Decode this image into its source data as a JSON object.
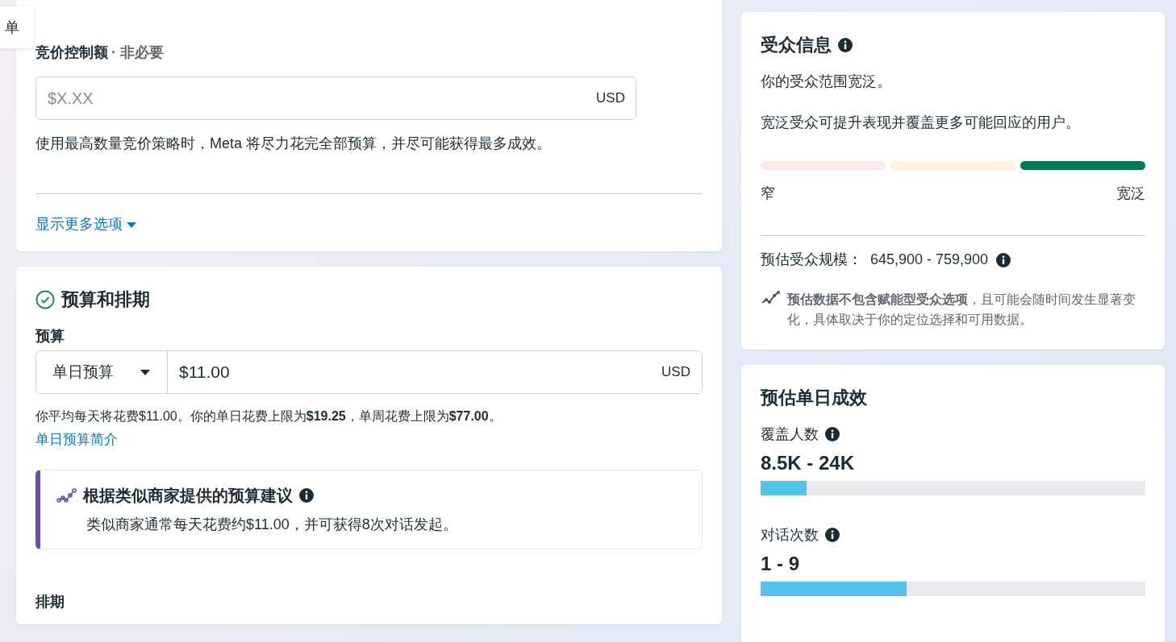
{
  "side_tab": {
    "label": "单"
  },
  "bid_card": {
    "label": "竞价控制额",
    "optional": "· 非必要",
    "field": {
      "placeholder": "$X.XX",
      "suffix": "USD"
    },
    "help": "使用最高数量竞价策略时，Meta 将尽力花完全部预算，并尽可能获得最多成效。",
    "more_link": "显示更多选项"
  },
  "budget_card": {
    "title": "预算和排期",
    "budget_label": "预算",
    "budget_type": "单日预算",
    "amount": "$11.00",
    "currency": "USD",
    "help": "你平均每天将花费$11.00。你的单日花费上限为**$19.25**，单周花费上限为**$77.00**。",
    "link": "单日预算简介",
    "suggestion": {
      "title": "根据类似商家提供的预算建议",
      "text": "类似商家通常每天花费约$11.00，并可获得8次对话发起。"
    },
    "schedule_label": "排期"
  },
  "audience_card": {
    "title": "受众信息",
    "summary": "你的受众范围宽泛。",
    "detail": "宽泛受众可提升表现并覆盖更多可能回应的用户。",
    "meter": [
      {
        "color": "#fde8e9"
      },
      {
        "color": "#fff3da"
      },
      {
        "color": "#007a56"
      }
    ],
    "low_label": "窄",
    "high_label": "宽泛",
    "size_label": "预估受众规模：",
    "size_value": "645,900 - 759,900",
    "note": "**预估数据不包含赋能型受众选项**，且可能会随时间发生显著变化，具体取决于你的定位选择和可用数据。"
  },
  "results_card": {
    "title": "预估单日成效",
    "metrics": [
      {
        "label": "覆盖人数",
        "value": "8.5K - 24K",
        "level": 0.12
      },
      {
        "label": "对话次数",
        "value": "1 - 9",
        "level": 0.38
      }
    ]
  }
}
